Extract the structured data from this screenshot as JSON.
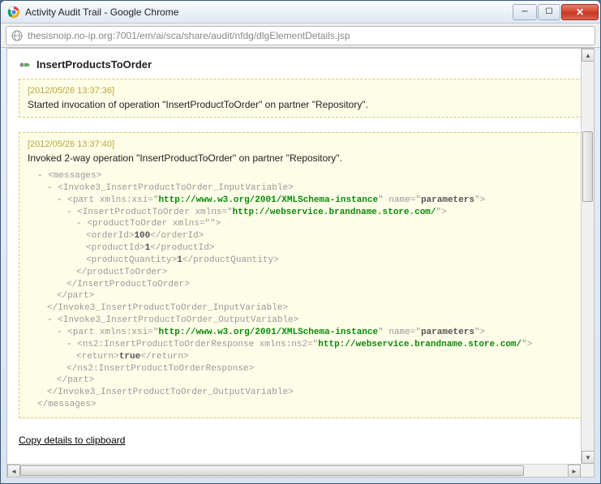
{
  "window": {
    "title": "Activity Audit Trail - Google Chrome",
    "url": "thesisnoip.no-ip.org:7001/em/ai/sca/share/audit/nfdg/dlgElementDetails.jsp"
  },
  "header": {
    "activity_name": "InsertProductsToOrder"
  },
  "blocks": [
    {
      "timestamp": "[2012/05/26 13:37:36]",
      "message": "Started invocation of operation \"InsertProductToOrder\" on partner \"Repository\"."
    },
    {
      "timestamp": "[2012/05/26 13:37:40]",
      "message": "Invoked 2-way operation \"InsertProductToOrder\" on partner \"Repository\".",
      "xml": {
        "xsi_ns": "http://www.w3.org/2001/XMLSchema-instance",
        "part_name": "parameters",
        "svc_ns": "http://webservice.brandname.store.com/",
        "orderId": "100",
        "productId": "1",
        "productQuantity": "1",
        "return_val": "true",
        "tags": {
          "messages": "messages",
          "inputVar": "Invoke3_InsertProductToOrder_InputVariable",
          "outputVar": "Invoke3_InsertProductToOrder_OutputVariable",
          "part": "part",
          "insertProductToOrder": "InsertProductToOrder",
          "productToOrder": "productToOrder",
          "orderId": "orderId",
          "productId": "productId",
          "productQuantity": "productQuantity",
          "response": "ns2:InsertProductToOrderResponse",
          "ret": "return"
        }
      }
    }
  ],
  "copy_link": "Copy details to clipboard"
}
